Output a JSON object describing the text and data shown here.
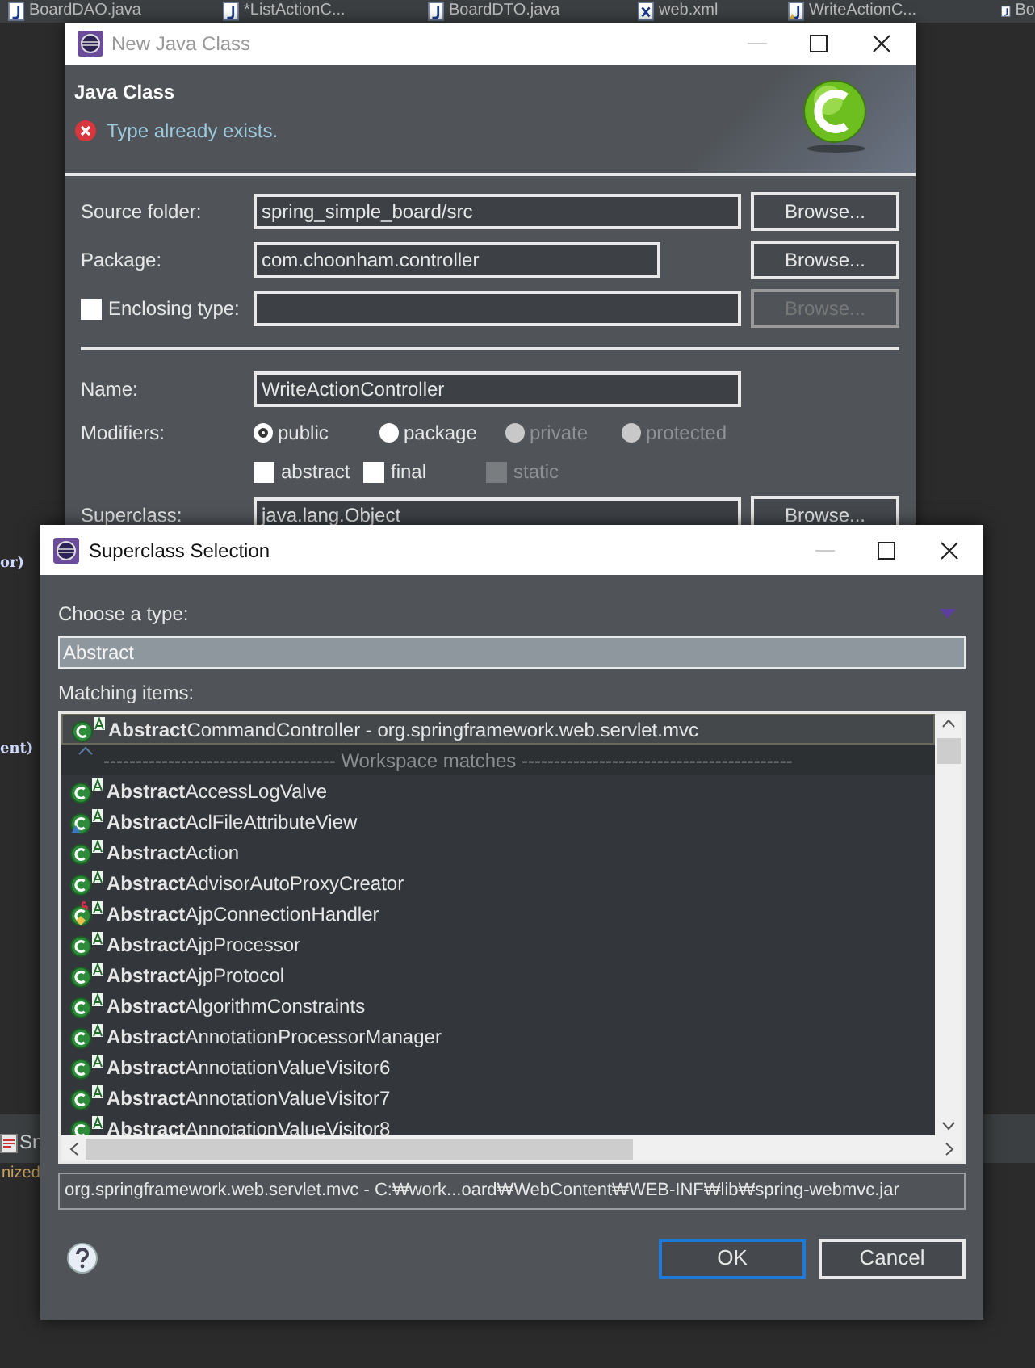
{
  "editor_tabs": [
    {
      "label": "BoardDAO.java",
      "kind": "java"
    },
    {
      "label": "*ListActionC...",
      "kind": "java"
    },
    {
      "label": "BoardDTO.java",
      "kind": "java"
    },
    {
      "label": "web.xml",
      "kind": "xml"
    },
    {
      "label": "WriteActionC...",
      "kind": "java-warning"
    },
    {
      "label": "Bo",
      "kind": "java"
    }
  ],
  "editor_fragments": [
    {
      "text": "or)",
      "kind": "code"
    },
    {
      "text": "ent)",
      "kind": "code"
    },
    {
      "text": "Sn",
      "kind": "panel-tab"
    },
    {
      "text": "nized",
      "kind": "console"
    }
  ],
  "new_java_class": {
    "title": "New Java Class",
    "heading": "Java Class",
    "message": "Type already exists.",
    "source_folder": {
      "label": "Source folder:",
      "value": "spring_simple_board/src",
      "button": "Browse..."
    },
    "package": {
      "label": "Package:",
      "value": "com.choonham.controller",
      "button": "Browse..."
    },
    "enclosing_type": {
      "label": "Enclosing type:",
      "checked": false,
      "button": "Browse...",
      "disabled": true
    },
    "name": {
      "label": "Name:",
      "value": "WriteActionController"
    },
    "modifiers": {
      "label": "Modifiers:",
      "radios": [
        {
          "label": "public",
          "selected": true,
          "disabled": false
        },
        {
          "label": "package",
          "selected": false,
          "disabled": false
        },
        {
          "label": "private",
          "selected": false,
          "disabled": true
        },
        {
          "label": "protected",
          "selected": false,
          "disabled": true
        }
      ],
      "checkboxes": [
        {
          "label": "abstract",
          "checked": false,
          "disabled": false
        },
        {
          "label": "final",
          "checked": false,
          "disabled": false
        },
        {
          "label": "static",
          "checked": false,
          "disabled": true
        }
      ]
    },
    "superclass": {
      "label": "Superclass:",
      "value": "java.lang.Object",
      "button": "Browse..."
    }
  },
  "superclass_selection": {
    "title": "Superclass Selection",
    "prompt": "Choose a type:",
    "filter": "Abstract",
    "matching_label": "Matching items:",
    "items": [
      {
        "kind": "class",
        "text": "**Abstract**CommandController - org.springframework.web.servlet.mvc",
        "selected": true
      },
      {
        "kind": "separator",
        "text": "------------------------------------ Workspace matches ------------------------------------------",
        "selected": false
      },
      {
        "kind": "class",
        "text": "**Abstract**AccessLogValve",
        "selected": false
      },
      {
        "kind": "class-linked",
        "text": "**Abstract**AclFileAttributeView",
        "selected": false
      },
      {
        "kind": "class",
        "text": "**Abstract**Action",
        "selected": false
      },
      {
        "kind": "class",
        "text": "**Abstract**AdvisorAutoProxyCreator",
        "selected": false
      },
      {
        "kind": "class-static",
        "text": "**Abstract**AjpConnectionHandler",
        "selected": false
      },
      {
        "kind": "class",
        "text": "**Abstract**AjpProcessor",
        "selected": false
      },
      {
        "kind": "class",
        "text": "**Abstract**AjpProtocol",
        "selected": false
      },
      {
        "kind": "class",
        "text": "**Abstract**AlgorithmConstraints",
        "selected": false
      },
      {
        "kind": "class",
        "text": "**Abstract**AnnotationProcessorManager",
        "selected": false
      },
      {
        "kind": "class",
        "text": "**Abstract**AnnotationValueVisitor6",
        "selected": false
      },
      {
        "kind": "class",
        "text": "**Abstract**AnnotationValueVisitor7",
        "selected": false
      },
      {
        "kind": "class",
        "text": "**Abstract**AnnotationValueVisitor8",
        "selected": false
      }
    ],
    "status": "org.springframework.web.servlet.mvc - C:₩work...oard₩WebContent₩WEB-INF₩lib₩spring-webmvc.jar",
    "buttons": [
      {
        "label": "OK",
        "default": true
      },
      {
        "label": "Cancel",
        "default": false
      }
    ]
  }
}
